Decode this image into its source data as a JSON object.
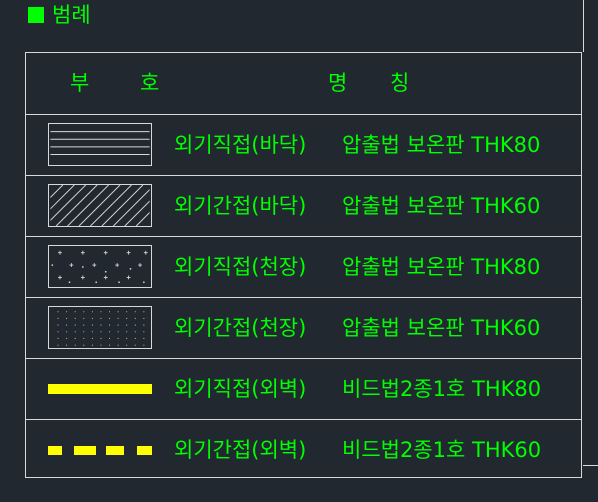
{
  "legend": {
    "title": "범례",
    "header": {
      "symbol": "부 호",
      "name": "명 칭"
    },
    "rows": [
      {
        "label": "외기직접(바닥)",
        "spec": "압출법 보온판 THK80",
        "pattern": "horizontal-lines-icon"
      },
      {
        "label": "외기간접(바닥)",
        "spec": "압출법 보온판 THK60",
        "pattern": "diagonal-hatch-icon"
      },
      {
        "label": "외기직접(천장)",
        "spec": "압출법 보온판 THK80",
        "pattern": "cross-dots-icon"
      },
      {
        "label": "외기간접(천장)",
        "spec": "압출법 보온판 THK60",
        "pattern": "fine-dots-icon"
      },
      {
        "label": "외기직접(외벽)",
        "spec": "비드법2종1호 THK80",
        "pattern": "solid-line-icon"
      },
      {
        "label": "외기간접(외벽)",
        "spec": "비드법2종1호 THK60",
        "pattern": "dashed-line-icon"
      }
    ]
  },
  "colors": {
    "background": "#212830",
    "text": "#00ff00",
    "border": "#d8d8d8",
    "insulation_line": "#ffff00"
  }
}
